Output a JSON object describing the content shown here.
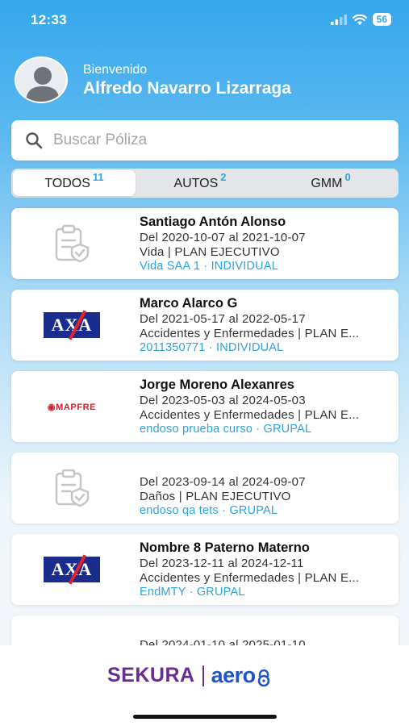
{
  "status": {
    "time": "12:33",
    "battery": "56"
  },
  "header": {
    "welcome": "Bienvenido",
    "user_name": "Alfredo Navarro Lizarraga"
  },
  "search": {
    "placeholder": "Buscar Póliza"
  },
  "tabs": [
    {
      "label": "TODOS",
      "count": "11",
      "active": true
    },
    {
      "label": "AUTOS",
      "count": "2",
      "active": false
    },
    {
      "label": "GMM",
      "count": "0",
      "active": false
    }
  ],
  "policies": [
    {
      "name": "Santiago Antón Alonso",
      "dates": "Del 2020-10-07 al 2021-10-07",
      "type": "Vida | PLAN EJECUTIVO",
      "ref": "Vida SAA 1 · INDIVIDUAL",
      "logo": "policy-placeholder"
    },
    {
      "name": "Marco Alarco G",
      "dates": "Del 2021-05-17 al 2022-05-17",
      "type": "Accidentes y Enfermedades | PLAN E...",
      "ref": "2011350771 · INDIVIDUAL",
      "logo": "axa",
      "logo_text": "AXA"
    },
    {
      "name": "Jorge Moreno Alexanres",
      "dates": "Del 2023-05-03 al 2024-05-03",
      "type": "Accidentes y Enfermedades | PLAN E...",
      "ref": "endoso prueba curso · GRUPAL",
      "logo": "mapfre",
      "logo_text": "MAPFRE"
    },
    {
      "name": "",
      "dates": "Del 2023-09-14 al 2024-09-07",
      "type": "Daños | PLAN EJECUTIVO",
      "ref": "endoso qa tets · GRUPAL",
      "logo": "policy-placeholder"
    },
    {
      "name": "Nombre 8 Paterno Materno",
      "dates": "Del 2023-12-11 al 2024-12-11",
      "type": "Accidentes y Enfermedades | PLAN E...",
      "ref": "EndMTY · GRUPAL",
      "logo": "axa",
      "logo_text": "AXA"
    },
    {
      "name": "",
      "dates": "Del 2024-01-10 al 2025-01-10",
      "type": "",
      "ref": "",
      "logo": ""
    }
  ],
  "footer": {
    "brand1": "SEKURA",
    "brand2": "aero"
  },
  "colors": {
    "primary": "#35a7ec",
    "accent": "#2aa3df",
    "sekura": "#6a2c91",
    "aero": "#1f54c8"
  }
}
